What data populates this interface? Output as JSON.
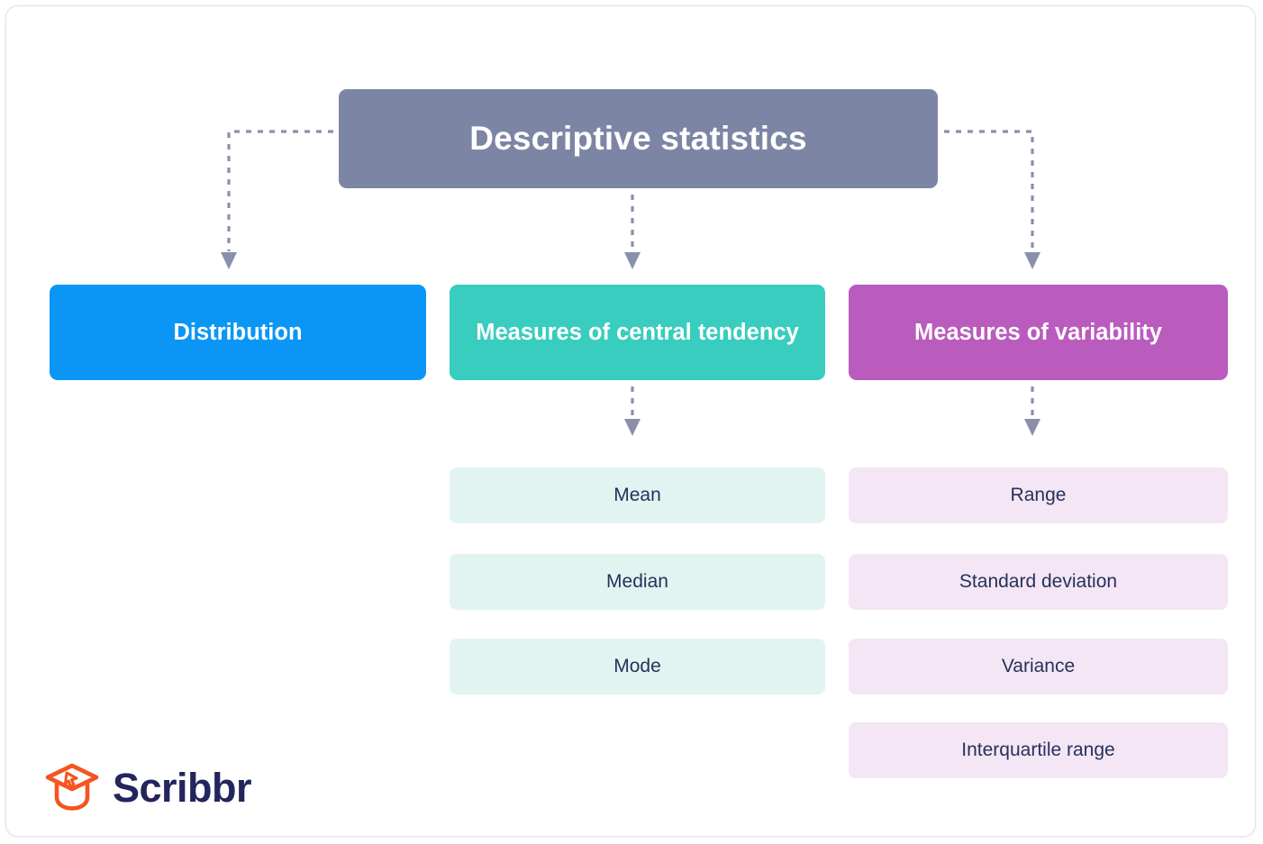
{
  "diagram": {
    "title": "Descriptive statistics",
    "root": {
      "label": "Descriptive statistics",
      "color": "#7d85a4",
      "text_color": "#ffffff"
    },
    "categories": [
      {
        "label": "Distribution",
        "color": "#0b96f5",
        "text_color": "#ffffff",
        "children": []
      },
      {
        "label": "Measures of central tendency",
        "color": "#38cdbe",
        "text_color": "#ffffff",
        "children": [
          "Mean",
          "Median",
          "Mode"
        ]
      },
      {
        "label": "Measures of variability",
        "color": "#ba5bbe",
        "text_color": "#ffffff",
        "children": [
          "Range",
          "Standard deviation",
          "Variance",
          "Interquartile range"
        ]
      }
    ],
    "leaf_colors": {
      "middle": "#e2f4f1",
      "right": "#f4e6f4",
      "text": "#26315c"
    },
    "connector_color": "#8a90ac",
    "connector_style": "dashed-with-arrowhead"
  },
  "branding": {
    "name": "Scribbr",
    "mark_color": "#f4541f",
    "wordmark_color": "#22265c"
  }
}
